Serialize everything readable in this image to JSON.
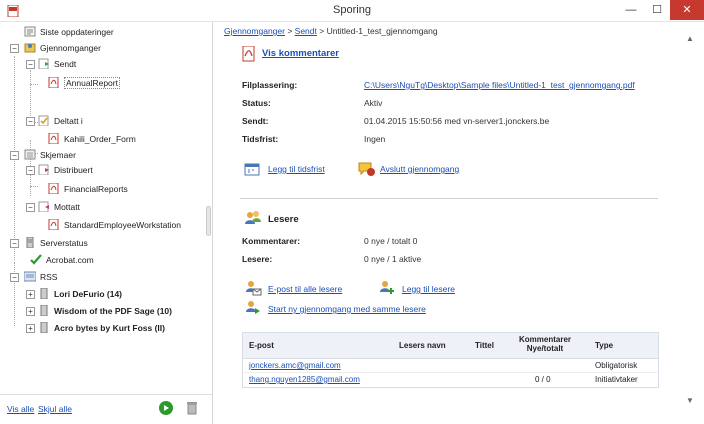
{
  "window": {
    "title": "Sporing",
    "minimize": "—",
    "maximize": "☐",
    "close": "✕"
  },
  "tree": {
    "updates": "Siste oppdateringer",
    "reviews": "Gjennomganger",
    "sent": "Sendt",
    "sent_item": "AnnualReport",
    "joined": "Deltatt i",
    "joined_item": "Kahili_Order_Form",
    "forms": "Skjemaer",
    "distributed": "Distribuert",
    "distributed_item": "FinancialReports",
    "received": "Mottatt",
    "received_item": "StandardEmployeeWorkstation",
    "server_status": "Serverstatus",
    "server_item": "Acrobat.com",
    "rss": "RSS",
    "feed1": "Lori DeFurio (14)",
    "feed2": "Wisdom of the PDF Sage (10)",
    "feed3": "Acro bytes by Kurt Foss (II)"
  },
  "left_footer": {
    "show_all": "Vis alle",
    "hide_all": "Skjul alle"
  },
  "breadcrumb": {
    "part1": "Gjennomganger",
    "sep1": " > ",
    "part2": "Sendt",
    "sep2": " > ",
    "current": "Untitled-1_test_gjennomgang"
  },
  "details": {
    "view_comments": "Vis kommentarer",
    "file_location_label": "Filplassering:",
    "file_location_value": "C:\\Users\\NguTg\\Desktop\\Sample files\\Untitled-1_test_gjennomgang.pdf",
    "status_label": "Status:",
    "status_value": "Aktiv",
    "sent_label": "Sendt:",
    "sent_value": "01.04.2015 15:50:56 med vn-server1.jonckers.be",
    "deadline_label": "Tidsfrist:",
    "deadline_value": "Ingen",
    "add_deadline": "Legg til tidsfrist",
    "end_review": "Avslutt gjennomgang"
  },
  "readers": {
    "heading": "Lesere",
    "comments_label": "Kommentarer:",
    "comments_value": "0 nye / totalt 0",
    "readers_label": "Lesere:",
    "readers_value": "0 nye / 1 aktive",
    "email_all": "E-post til alle lesere",
    "add_readers": "Legg til lesere",
    "start_new": "Start ny gjennomgang med samme lesere"
  },
  "table": {
    "headers": {
      "email": "E-post",
      "reader_name": "Lesers navn",
      "title": "Tittel",
      "comments": "Kommentarer Nye/totalt",
      "type": "Type"
    },
    "rows": [
      {
        "email": "jonckers.amc@gmail.com",
        "name": "",
        "title": "",
        "comments": "",
        "type": "Obligatorisk"
      },
      {
        "email": "thang.nguyen1285@gmail.com",
        "name": "",
        "title": "",
        "comments": "0 / 0",
        "type": "Initiativtaker"
      }
    ]
  }
}
